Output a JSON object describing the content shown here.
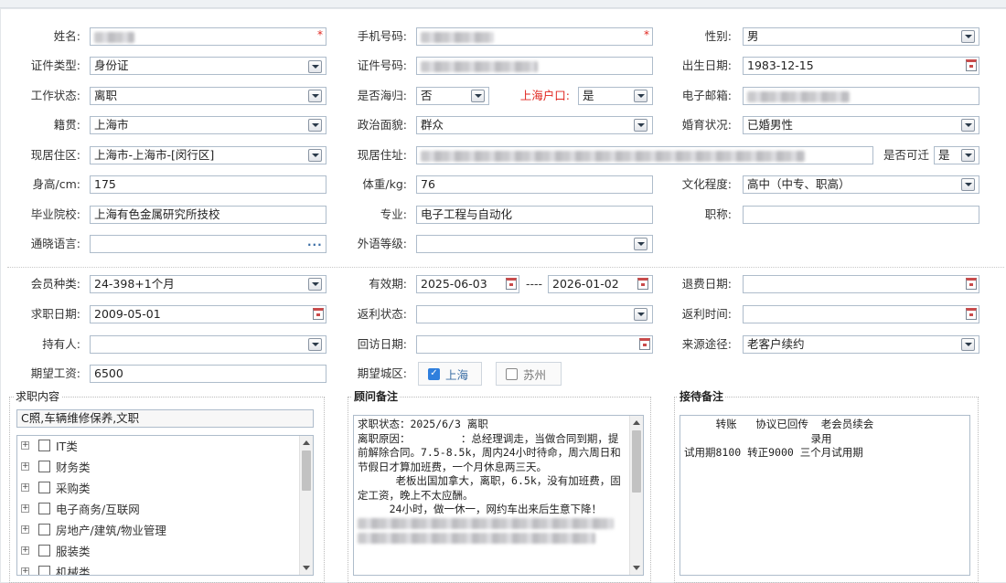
{
  "form": {
    "name": {
      "label": "姓名:",
      "value": ""
    },
    "phone": {
      "label": "手机号码:",
      "value": ""
    },
    "gender": {
      "label": "性别:",
      "value": "男"
    },
    "id_type": {
      "label": "证件类型:",
      "value": "身份证"
    },
    "id_number": {
      "label": "证件号码:",
      "value": ""
    },
    "birth_date": {
      "label": "出生日期:",
      "value": "1983-12-15"
    },
    "work_status": {
      "label": "工作状态:",
      "value": "离职"
    },
    "returnee": {
      "label": "是否海归:",
      "value": "否"
    },
    "shanghai_hukou": {
      "label": "上海户口:",
      "value": "是"
    },
    "email": {
      "label": "电子邮箱:",
      "value": ""
    },
    "native_place": {
      "label": "籍贯:",
      "value": "上海市"
    },
    "political": {
      "label": "政治面貌:",
      "value": "群众"
    },
    "marital": {
      "label": "婚育状况:",
      "value": "已婚男性"
    },
    "current_area": {
      "label": "现居住区:",
      "value": "上海市-上海市-[闵行区]"
    },
    "current_address": {
      "label": "现居住址:",
      "value": ""
    },
    "relocate": {
      "label": "是否可迁",
      "value": "是"
    },
    "height": {
      "label": "身高/cm:",
      "value": "175"
    },
    "weight": {
      "label": "体重/kg:",
      "value": "76"
    },
    "education": {
      "label": "文化程度:",
      "value": "高中（中专、职高）"
    },
    "school": {
      "label": "毕业院校:",
      "value": "上海有色金属研究所技校"
    },
    "major": {
      "label": "专业:",
      "value": "电子工程与自动化"
    },
    "title": {
      "label": "职称:",
      "value": ""
    },
    "languages": {
      "label": "通晓语言:",
      "value": ""
    },
    "foreign_level": {
      "label": "外语等级:",
      "value": ""
    }
  },
  "membership": {
    "member_type": {
      "label": "会员种类:",
      "value": "24-398+1个月"
    },
    "validity": {
      "label": "有效期:",
      "from": "2025-06-03",
      "sep": "----",
      "to": "2026-01-02"
    },
    "refund_date": {
      "label": "退费日期:",
      "value": ""
    },
    "job_date": {
      "label": "求职日期:",
      "value": "2009-05-01"
    },
    "rebate_status": {
      "label": "返利状态:",
      "value": ""
    },
    "rebate_time": {
      "label": "返利时间:",
      "value": ""
    },
    "holder": {
      "label": "持有人:",
      "value": ""
    },
    "visit_date": {
      "label": "回访日期:",
      "value": ""
    },
    "source": {
      "label": "来源途径:",
      "value": "老客户续约"
    },
    "salary": {
      "label": "期望工资:",
      "value": "6500"
    },
    "city": {
      "label": "期望城区:",
      "options": [
        {
          "name": "上海",
          "checked": true
        },
        {
          "name": "苏州",
          "checked": false
        }
      ]
    }
  },
  "job_content": {
    "title": "求职内容",
    "selected": "C照,车辆维修保养,文职",
    "categories": [
      "IT类",
      "财务类",
      "采购类",
      "电子商务/互联网",
      "房地产/建筑/物业管理",
      "服装类",
      "机械类"
    ]
  },
  "consultant_note": {
    "title": "顾问备注",
    "lines": [
      "求职状态：2025/6/3 离职",
      "离职原因：        ：总经理调走，当做合同到期，提前解除合同。7.5-8.5k，周内24小时待命，周六周日和节假日才算加班费，一个月休息两三天。",
      "      老板出国加拿大，离职，6.5k，没有加班费，固定工资，晚上不太应酬。",
      "     24小时，做一休一，网约车出来后生意下降！"
    ]
  },
  "reception_note": {
    "title": "接待备注",
    "lines": [
      "     转账   协议已回传  老会员续会",
      "",
      "                    录用",
      "试用期8100 转正9000 三个月试用期"
    ]
  }
}
